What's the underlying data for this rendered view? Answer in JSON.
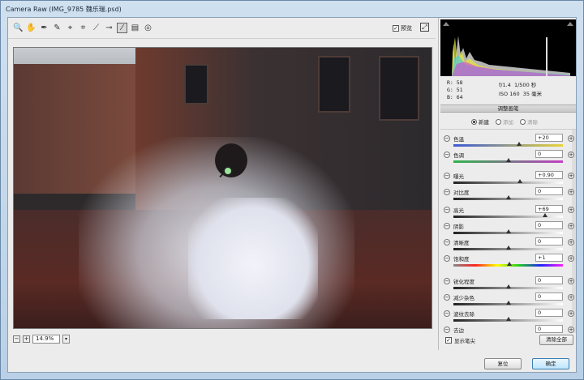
{
  "window": {
    "title": "Camera Raw (IMG_9785 魏乐瑞.psd)"
  },
  "toolbar": {
    "tools": [
      {
        "name": "zoom-tool-icon",
        "glyph": "🔍"
      },
      {
        "name": "hand-tool-icon",
        "glyph": "✋"
      },
      {
        "name": "white-balance-tool-icon",
        "glyph": "✒"
      },
      {
        "name": "color-sampler-tool-icon",
        "glyph": "✎"
      },
      {
        "name": "targeted-adjustment-tool-icon",
        "glyph": "⌖"
      },
      {
        "name": "crop-tool-icon",
        "glyph": "⌗"
      },
      {
        "name": "straighten-tool-icon",
        "glyph": "⟋"
      },
      {
        "name": "spot-removal-tool-icon",
        "glyph": "⊸"
      },
      {
        "name": "adjustment-brush-tool-icon",
        "glyph": "⁄"
      },
      {
        "name": "graduated-filter-tool-icon",
        "glyph": "▤"
      },
      {
        "name": "radial-filter-tool-icon",
        "glyph": "◎"
      }
    ],
    "preview_label": "预览",
    "preview_checked": "✓"
  },
  "status": {
    "zoom": "14.9%",
    "minus": "−",
    "plus": "+",
    "drop": "▾"
  },
  "info": {
    "r_label": "R:",
    "r": "58",
    "g_label": "G:",
    "g": "51",
    "b_label": "B:",
    "b": "64",
    "aperture": "f/1.4",
    "shutter": "1/500 秒",
    "iso": "ISO 160",
    "focal": "35 毫米"
  },
  "panel": {
    "title": "调整画笔",
    "modes": [
      {
        "label": "新建",
        "selected": true
      },
      {
        "label": "添加",
        "selected": false
      },
      {
        "label": "清除",
        "selected": false
      }
    ],
    "sliders": [
      {
        "label": "色温",
        "value": "+20",
        "pos": 0.6,
        "track": "linear-gradient(90deg,#3b5bd6,#e8d43a)"
      },
      {
        "label": "色调",
        "value": "0",
        "pos": 0.5,
        "track": "linear-gradient(90deg,#2fb34a,#c23fc4)"
      },
      {
        "label": "曝光",
        "value": "+0.90",
        "pos": 0.61,
        "track": "linear-gradient(90deg,#222,#fff)"
      },
      {
        "label": "对比度",
        "value": "0",
        "pos": 0.5,
        "track": "linear-gradient(90deg,#222,#fff)"
      },
      {
        "label": "高光",
        "value": "+69",
        "pos": 0.84,
        "track": "linear-gradient(90deg,#222,#fff)"
      },
      {
        "label": "阴影",
        "value": "0",
        "pos": 0.5,
        "track": "linear-gradient(90deg,#222,#fff)"
      },
      {
        "label": "清晰度",
        "value": "0",
        "pos": 0.5,
        "track": "linear-gradient(90deg,#222,#fff)"
      },
      {
        "label": "饱和度",
        "value": "+1",
        "pos": 0.51,
        "track": "linear-gradient(90deg,#888,#f22,#ff0,#2c2,#22f,#f2f)"
      },
      {
        "label": "锐化程度",
        "value": "0",
        "pos": 0.5,
        "track": "linear-gradient(90deg,#222,#fff)"
      },
      {
        "label": "减少杂色",
        "value": "0",
        "pos": 0.5,
        "track": "linear-gradient(90deg,#222,#fff)"
      },
      {
        "label": "波纹去除",
        "value": "0",
        "pos": 0.5,
        "track": "linear-gradient(90deg,#222,#fff)"
      },
      {
        "label": "去边",
        "value": "0",
        "pos": 0.5,
        "track": "linear-gradient(90deg,#222,#fff)"
      }
    ],
    "show_pins_label": "显示笔尖",
    "show_pins_checked": "✓",
    "clear_all_label": "清除全部"
  },
  "buttons": {
    "reset": "复位",
    "ok": "确定"
  }
}
